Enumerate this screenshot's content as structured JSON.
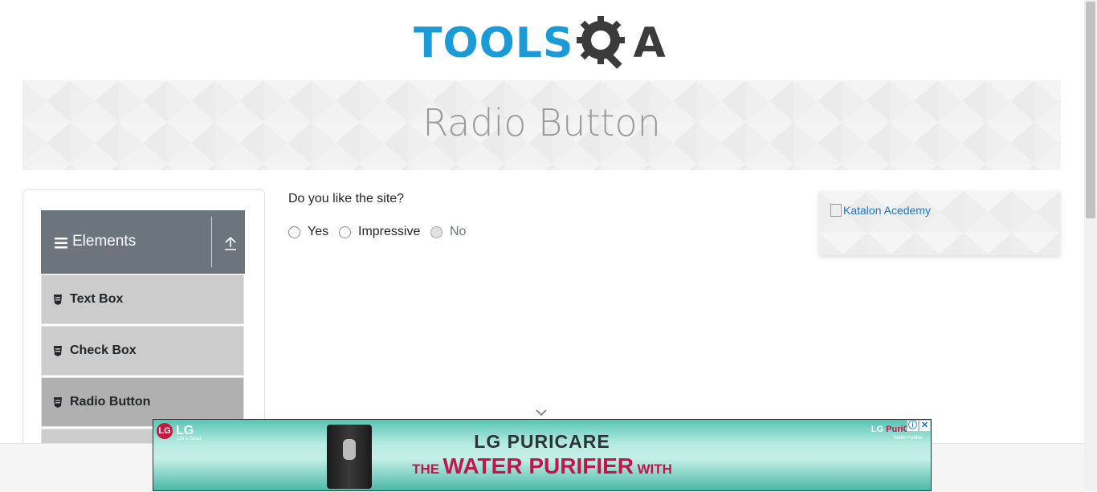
{
  "header": {
    "logo_tools": "TOOLS",
    "logo_a": "A",
    "logo_alt": "ToolsQA logo"
  },
  "banner": {
    "title": "Radio Button"
  },
  "sidebar": {
    "group": {
      "title": "Elements",
      "menu_icon": "hamburger-icon",
      "collapse_icon": "collapse-up-icon"
    },
    "items": [
      {
        "label": "Text Box",
        "icon": "form-icon",
        "active": false
      },
      {
        "label": "Check Box",
        "icon": "form-icon",
        "active": false
      },
      {
        "label": "Radio Button",
        "icon": "form-icon",
        "active": true
      }
    ]
  },
  "main": {
    "question": "Do you like the site?",
    "options": [
      {
        "label": "Yes",
        "disabled": false
      },
      {
        "label": "Impressive",
        "disabled": false
      },
      {
        "label": "No",
        "disabled": true
      }
    ]
  },
  "right_ad": {
    "broken_image_alt": "Katalon Acedemy"
  },
  "bottom_ad": {
    "brand_logo": "LG",
    "brand_tagline": "Life's Good",
    "headline": "LG  PURICARE",
    "sub_prefix": "THE",
    "sub_main": "WATER PURIFIER",
    "sub_suffix": "WITH",
    "right_logo_lg": "LG",
    "right_logo_pur": "PuriCare",
    "right_logo_sub": "Water Purifier",
    "info_icon": "ⓘ",
    "close_icon": "✕"
  },
  "colors": {
    "brand_blue": "#1a9ad6",
    "brand_dark": "#3b3b3b",
    "sidebar_header": "#6c757d",
    "menu_item": "#cccccc",
    "menu_item_active": "#b0b0b0",
    "ad_accent": "#c0164a"
  }
}
